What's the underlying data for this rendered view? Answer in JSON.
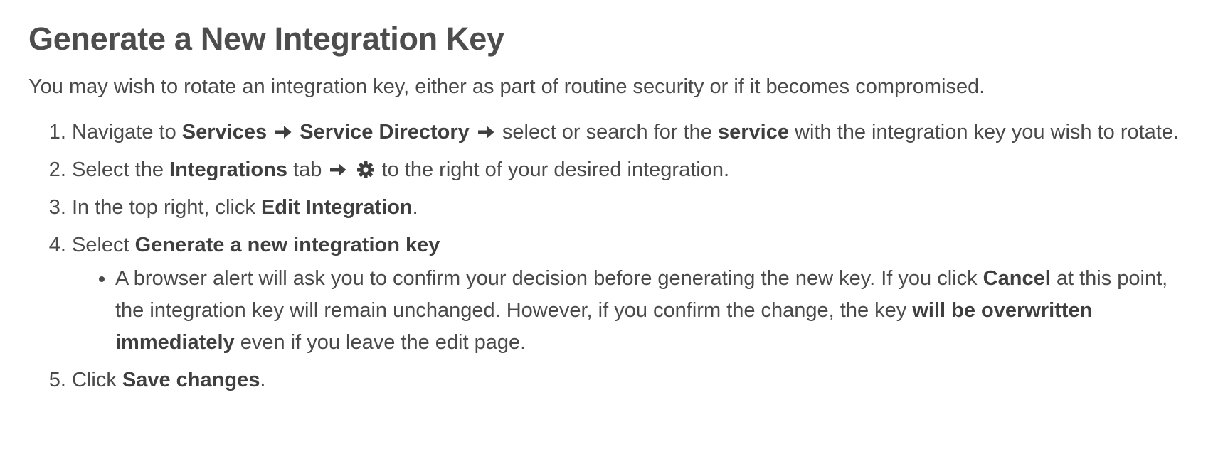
{
  "heading": "Generate a New Integration Key",
  "intro": "You may wish to rotate an integration key, either as part of routine security or if it becomes compromised.",
  "steps": {
    "s1": {
      "t1": "Navigate to ",
      "b1": "Services",
      "b2": "Service Directory",
      "t2": " select or search for the ",
      "b3": "service",
      "t3": " with the integration key you wish to rotate."
    },
    "s2": {
      "t1": "Select the ",
      "b1": "Integrations",
      "t2": " tab ",
      "t3": " to the right of your desired integration."
    },
    "s3": {
      "t1": "In the top right, click ",
      "b1": "Edit Integration",
      "t2": "."
    },
    "s4": {
      "t1": "Select ",
      "b1": "Generate a new integration key",
      "sub": {
        "t1": "A browser alert will ask you to confirm your decision before generating the new key. If you click ",
        "b1": "Cancel",
        "t2": " at this point, the integration key will remain unchanged. However, if you confirm the change, the key ",
        "b2": "will be overwritten immediately",
        "t3": " even if you leave the edit page."
      }
    },
    "s5": {
      "t1": "Click ",
      "b1": "Save changes",
      "t2": "."
    }
  },
  "icons": {
    "arrow": "arrow-right-icon",
    "gear": "gear-icon"
  },
  "colors": {
    "text": "#4a4a4a",
    "heading": "#4d4d4d"
  }
}
